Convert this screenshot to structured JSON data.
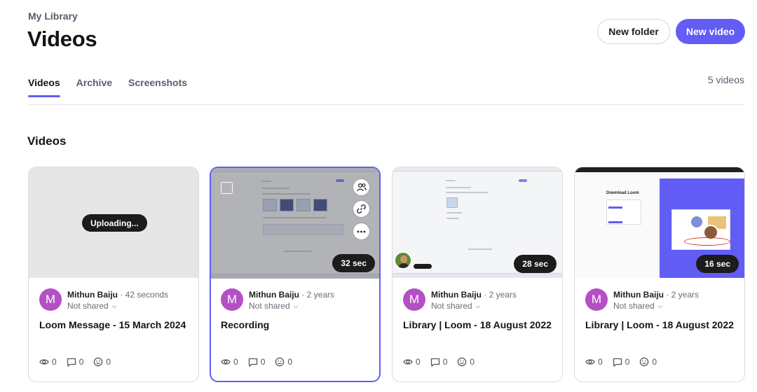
{
  "header": {
    "breadcrumb": "My Library",
    "title": "Videos",
    "new_folder_label": "New folder",
    "new_video_label": "New video"
  },
  "tabs": [
    {
      "label": "Videos",
      "active": true
    },
    {
      "label": "Archive",
      "active": false
    },
    {
      "label": "Screenshots",
      "active": false
    }
  ],
  "video_count": "5 videos",
  "section_title": "Videos",
  "colors": {
    "accent": "#625df5",
    "avatar": "#b44fc6"
  },
  "cards": [
    {
      "status_badge": "Uploading...",
      "avatar_initial": "M",
      "author": "Mithun Baiju",
      "time": "· 42 seconds",
      "share_status": "Not shared",
      "title": "Loom Message - 15 March 2024",
      "views": "0",
      "comments": "0",
      "reactions": "0"
    },
    {
      "duration": "32 sec",
      "avatar_initial": "M",
      "author": "Mithun Baiju",
      "time": "· 2 years",
      "share_status": "Not shared",
      "title": "Recording",
      "views": "0",
      "comments": "0",
      "reactions": "0"
    },
    {
      "duration": "28 sec",
      "avatar_initial": "M",
      "author": "Mithun Baiju",
      "time": "· 2 years",
      "share_status": "Not shared",
      "title": "Library | Loom - 18 August 2022",
      "views": "0",
      "comments": "0",
      "reactions": "0"
    },
    {
      "duration": "16 sec",
      "thumb_heading": "Download Loom",
      "avatar_initial": "M",
      "author": "Mithun Baiju",
      "time": "· 2 years",
      "share_status": "Not shared",
      "title": "Library | Loom - 18 August 2022",
      "views": "0",
      "comments": "0",
      "reactions": "0"
    }
  ]
}
